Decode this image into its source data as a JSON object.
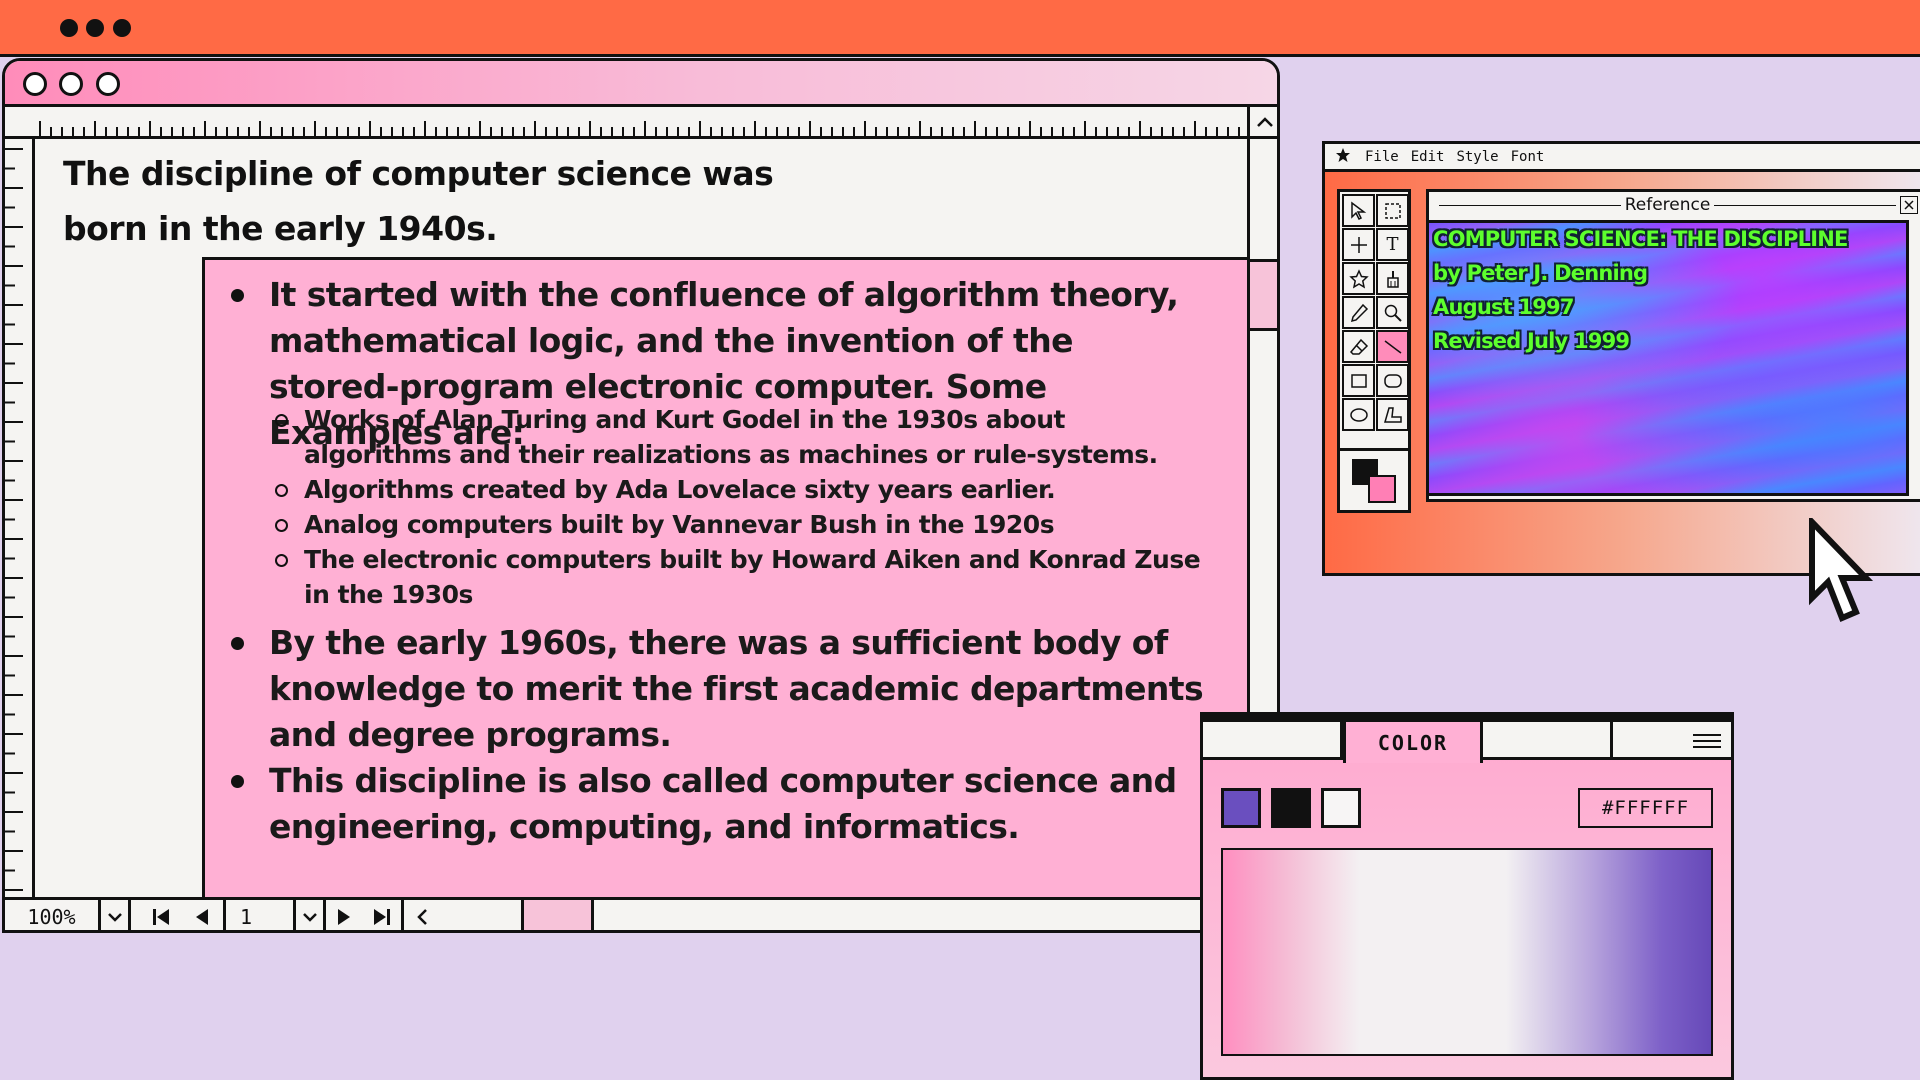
{
  "document": {
    "heading": "The discipline of computer science was born in the early 1940s.",
    "bullets": [
      "It started with the confluence of algorithm theory, mathematical logic, and the invention of the stored-program electronic computer. Some Examples are:",
      " By the early 1960s, there was a sufficient body of knowledge to merit the first academic departments and degree programs.",
      "This discipline is also called computer science and engineering, computing, and informatics."
    ],
    "sub_bullets": [
      "Works of Alan Turing and Kurt Godel in the 1930s about algorithms and their realizations as machines or rule-systems.",
      "Algorithms created by Ada Lovelace sixty years earlier.",
      "Analog computers built by Vannevar Bush in the 1920s",
      "The electronic computers built by Howard Aiken and Konrad Zuse in the 1930s"
    ]
  },
  "statusbar": {
    "zoom": "100%",
    "page": "1"
  },
  "reference_window": {
    "menu": [
      "File",
      "Edit",
      "Style",
      "Font"
    ],
    "panel_title": "Reference",
    "lines": [
      "COMPUTER SCIENCE: THE DISCIPLINE",
      "by Peter J. Denning",
      "August 1997",
      "Revised July 1999"
    ]
  },
  "color_window": {
    "tab_label": "COLOR",
    "hex_value": "#FFFFFF",
    "swatches": [
      "#6a4fbf",
      "#111111",
      "#f7f5f5"
    ]
  },
  "colors": {
    "topbar": "#ff6a45",
    "background": "#e0d1ee",
    "content_pink": "#ffb0d4",
    "neon_text": "#5dff2d"
  }
}
